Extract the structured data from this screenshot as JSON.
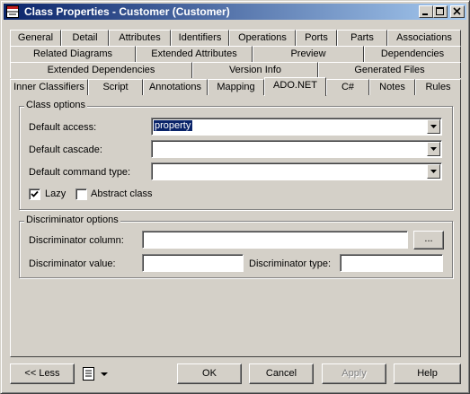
{
  "window": {
    "title": "Class Properties - Customer (Customer)",
    "minimize_icon": "minimize-icon",
    "maximize_icon": "maximize-icon",
    "close_icon": "close-icon"
  },
  "tabs": {
    "row1": [
      "General",
      "Detail",
      "Attributes",
      "Identifiers",
      "Operations",
      "Ports",
      "Parts",
      "Associations"
    ],
    "row2": [
      "Related Diagrams",
      "Extended Attributes",
      "Preview",
      "Dependencies"
    ],
    "row3": [
      "Extended Dependencies",
      "Version Info",
      "Generated Files"
    ],
    "row4": [
      "Inner Classifiers",
      "Script",
      "Annotations",
      "Mapping",
      "ADO.NET",
      "C#",
      "Notes",
      "Rules"
    ],
    "active": "ADO.NET"
  },
  "class_options": {
    "group_label": "Class options",
    "default_access_label": "Default access:",
    "default_access_value": "property",
    "default_cascade_label": "Default cascade:",
    "default_cascade_value": "",
    "default_command_type_label": "Default command type:",
    "default_command_type_value": "",
    "lazy_label": "Lazy",
    "lazy_checked": true,
    "abstract_label": "Abstract class",
    "abstract_checked": false
  },
  "discriminator_options": {
    "group_label": "Discriminator options",
    "column_label": "Discriminator column:",
    "column_value": "",
    "browse_label": "...",
    "value_label": "Discriminator value:",
    "value_value": "",
    "type_label": "Discriminator type:",
    "type_value": ""
  },
  "footer": {
    "less_label": "<< Less",
    "ok_label": "OK",
    "cancel_label": "Cancel",
    "apply_label": "Apply",
    "help_label": "Help"
  }
}
